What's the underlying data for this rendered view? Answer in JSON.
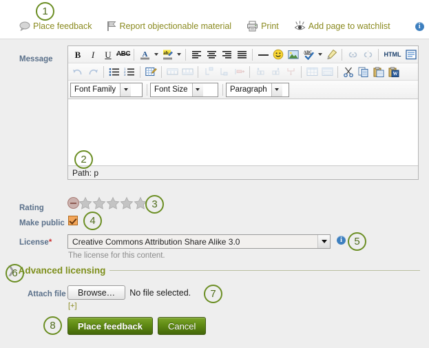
{
  "topbar": {
    "actions": [
      {
        "label": "Place feedback",
        "icon": "speech-bubble-icon"
      },
      {
        "label": "Report objectionable material",
        "icon": "flag-icon"
      },
      {
        "label": "Print",
        "icon": "printer-icon"
      },
      {
        "label": "Add page to watchlist",
        "icon": "eye-icon"
      }
    ],
    "info_icon": "info-icon",
    "info_glyph": "i"
  },
  "form": {
    "message_label": "Message",
    "rating_label": "Rating",
    "make_public_label": "Make public",
    "license_label": "License",
    "license_required_mark": "*",
    "license_value": "Creative Commons Attribution Share Alike 3.0",
    "license_help": "The license for this content.",
    "advanced_licensing_label": "Advanced licensing",
    "advanced_arrow_glyph": "❯",
    "attach_file_label": "Attach file",
    "browse_label": "Browse…",
    "no_file_label": "No file selected.",
    "add_more_label": "[+]",
    "submit_label": "Place feedback",
    "cancel_label": "Cancel"
  },
  "editor": {
    "path_status": "Path: p",
    "content": "",
    "selects": [
      {
        "label": "Font Family",
        "name": "font-family-select"
      },
      {
        "label": "Font Size",
        "name": "font-size-select"
      },
      {
        "label": "Paragraph",
        "name": "paragraph-format-select"
      }
    ],
    "row1_buttons": [
      "bold-icon",
      "italic-icon",
      "underline-icon",
      "strikethrough-icon",
      "text-color-icon",
      "background-color-icon",
      "align-left-icon",
      "align-center-icon",
      "align-right-icon",
      "align-justify-icon",
      "horizontal-rule-icon",
      "emoticon-icon",
      "insert-image-icon",
      "spellcheck-icon",
      "remove-formatting-icon",
      "insert-link-icon",
      "unlink-icon",
      "html-source-icon",
      "fullscreen-icon"
    ],
    "row2_buttons": [
      "undo-icon",
      "redo-icon",
      "bullet-list-icon",
      "numbered-list-icon",
      "edit-table-icon",
      "insert-row-icon",
      "delete-row-icon",
      "indent-left-icon",
      "indent-right-icon",
      "outdent-icon",
      "merge-cells-icon",
      "split-cells-icon",
      "table-props-icon",
      "insert-table-icon",
      "table-cell-icon",
      "cut-icon",
      "copy-icon",
      "paste-icon",
      "paste-word-icon"
    ]
  },
  "rating": {
    "no_rating_icon": "no-rating-icon",
    "star_count": 5,
    "stars_filled": 0
  },
  "make_public": {
    "checked": true
  },
  "callouts": [
    {
      "number": "1"
    },
    {
      "number": "2"
    },
    {
      "number": "3"
    },
    {
      "number": "4"
    },
    {
      "number": "5"
    },
    {
      "number": "6"
    },
    {
      "number": "7"
    },
    {
      "number": "8"
    }
  ],
  "colors": {
    "link_olive": "#8a8a1f",
    "callout_green": "#6b8e23",
    "label_blue": "#5a708a",
    "button_green": "#5f8a14",
    "panel_bg": "#eeeeee",
    "info_blue": "#3d7fbf",
    "required_red": "#cc3333"
  }
}
